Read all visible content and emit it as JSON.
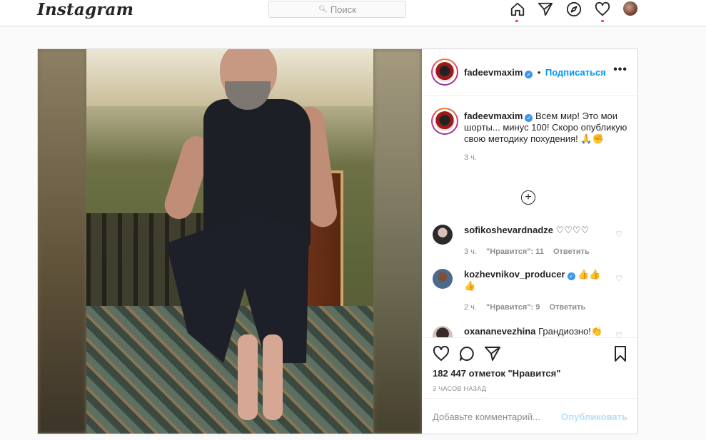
{
  "topbar": {
    "logo": "Instagram",
    "search_placeholder": "Поиск",
    "icons": [
      "home-icon",
      "direct-icon",
      "explore-icon",
      "activity-heart-icon",
      "profile-avatar"
    ]
  },
  "post": {
    "username": "fadeevmaxim",
    "follow_label": "Подписаться",
    "caption_user": "fadeevmaxim",
    "caption_text": "Всем мир! Это мои шорты... минус 100! Скоро опубликую свою методику похудения! 🙏✊",
    "caption_time": "3 ч.",
    "comments": [
      {
        "user": "sofikoshevardnadze",
        "text": "♡♡♡♡",
        "time": "3 ч.",
        "likes": "\"Нравится\": 11",
        "reply": "Ответить"
      },
      {
        "user": "kozhevnikov_producer",
        "text": "👍👍👍",
        "time": "2 ч.",
        "likes": "\"Нравится\": 9",
        "reply": "Ответить"
      },
      {
        "user": "oxananevezhina",
        "text": "Грандиозно!👏"
      }
    ],
    "likes_count": "182 447 отметок \"Нравится\"",
    "posted_ago": "3 ЧАСОВ НАЗАД",
    "add_comment_placeholder": "Добавьте комментарий...",
    "publish_label": "Опубликовать"
  },
  "colors": {
    "accent_blue": "#0095f6",
    "verified_blue": "#3897f0",
    "notification_red": "#ed4956",
    "publish_disabled": "#b2dffc"
  }
}
